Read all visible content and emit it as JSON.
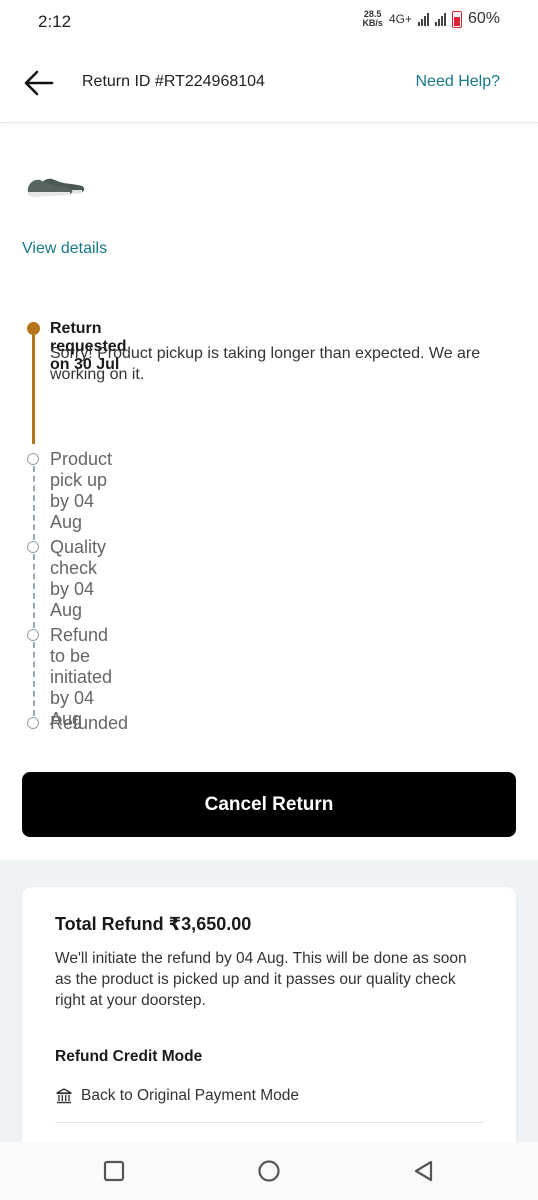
{
  "status_bar": {
    "time": "2:12",
    "net_speed_value": "28.5",
    "net_speed_unit": "KB/s",
    "network": "4G+",
    "battery": "60%"
  },
  "header": {
    "return_id": "Return ID #RT224968104",
    "help_label": "Need Help?",
    "back_icon": "arrow-left-icon"
  },
  "product": {
    "image_icon": "shoe-icon",
    "view_details_label": "View details"
  },
  "timeline": {
    "steps": [
      {
        "title": "Return requested on 30 Jul",
        "description": "Sorry! Product pickup is taking longer than expected. We are working on it.",
        "status": "done"
      },
      {
        "title": "Product pick up by  04 Aug",
        "status": "pending"
      },
      {
        "title": "Quality check by 04 Aug",
        "status": "pending"
      },
      {
        "title": "Refund to be initiated by 04 Aug",
        "status": "pending"
      },
      {
        "title": "Refunded",
        "status": "pending"
      }
    ]
  },
  "actions": {
    "cancel_label": "Cancel Return"
  },
  "refund": {
    "title": "Total Refund ₹3,650.00",
    "description": "We'll initiate the refund by 04 Aug. This will be done as soon as the product is picked up and it passes our quality check right at your doorstep.",
    "mode_label": "Refund Credit Mode",
    "mode_value": "Back to Original Payment Mode",
    "mode_icon": "bank-icon"
  },
  "nav": {
    "recents_icon": "square-icon",
    "home_icon": "circle-icon",
    "back_icon": "triangle-back-icon"
  },
  "colors": {
    "accent_link": "#17788a",
    "timeline_done": "#b5751a",
    "primary_button": "#000000",
    "refund_bg": "#eef3f6"
  }
}
